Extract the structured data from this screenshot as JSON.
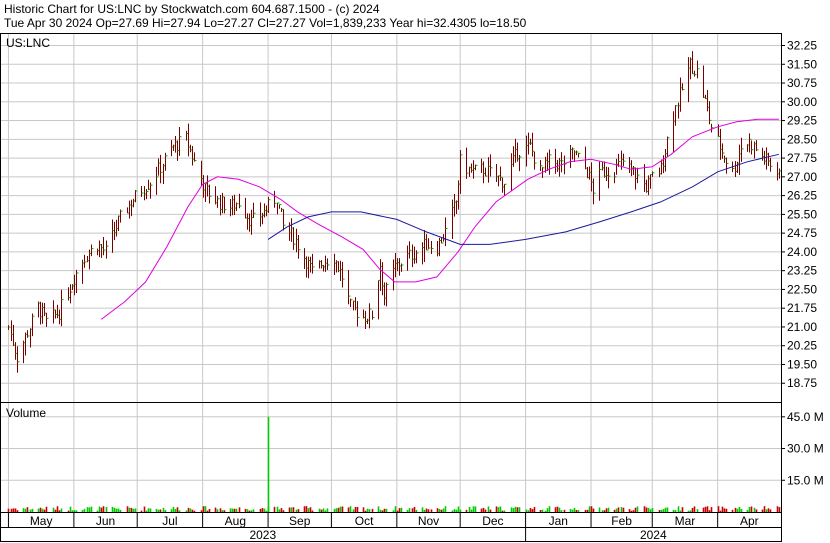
{
  "header": {
    "line1": "Historic Chart for US:LNC by Stockwatch.com 604.687.1500 - (c) 2024",
    "line2": "Tue Apr 30 2024   Op=27.69  Hi=27.94  Lo=27.27  Cl=27.27  Vol=1,839,233  Year hi=32.4305  lo=18.50"
  },
  "chart_data": {
    "type": "ohlc",
    "symbol_label": "US:LNC",
    "volume_label": "Volume",
    "price_ticks": [
      "32.25",
      "31.50",
      "30.75",
      "30.00",
      "29.25",
      "28.50",
      "27.75",
      "27.00",
      "26.25",
      "25.50",
      "24.75",
      "24.00",
      "23.25",
      "22.50",
      "21.75",
      "21.00",
      "20.25",
      "19.50",
      "18.75"
    ],
    "volume_ticks": [
      "45.0 M",
      "30.0 M",
      "15.0 M"
    ],
    "month_labels": [
      "May",
      "Jun",
      "Jul",
      "Aug",
      "Sep",
      "Oct",
      "Nov",
      "Dec",
      "Jan",
      "Feb",
      "Mar",
      "Apr"
    ],
    "year_labels": [
      "2023",
      "2024"
    ],
    "price_range": [
      18.0,
      32.75
    ],
    "volume_range_millions": [
      0,
      52
    ],
    "price_series": [
      [
        "2023-05-01",
        21.0
      ],
      [
        "2023-05-05",
        19.8
      ],
      [
        "2023-05-10",
        20.8
      ],
      [
        "2023-05-15",
        21.8
      ],
      [
        "2023-05-19",
        21.2
      ],
      [
        "2023-05-25",
        21.6
      ],
      [
        "2023-06-01",
        23.0
      ],
      [
        "2023-06-06",
        23.8
      ],
      [
        "2023-06-12",
        24.3
      ],
      [
        "2023-06-16",
        24.0
      ],
      [
        "2023-06-22",
        25.2
      ],
      [
        "2023-06-28",
        26.0
      ],
      [
        "2023-07-03",
        26.5
      ],
      [
        "2023-07-07",
        26.8
      ],
      [
        "2023-07-12",
        27.4
      ],
      [
        "2023-07-18",
        28.2
      ],
      [
        "2023-07-24",
        28.5
      ],
      [
        "2023-07-28",
        27.6
      ],
      [
        "2023-08-02",
        26.5
      ],
      [
        "2023-08-08",
        26.0
      ],
      [
        "2023-08-14",
        25.8
      ],
      [
        "2023-08-18",
        26.0
      ],
      [
        "2023-08-24",
        25.2
      ],
      [
        "2023-08-30",
        25.6
      ],
      [
        "2023-09-05",
        26.2
      ],
      [
        "2023-09-08",
        25.0
      ],
      [
        "2023-09-13",
        24.6
      ],
      [
        "2023-09-18",
        23.8
      ],
      [
        "2023-09-22",
        23.2
      ],
      [
        "2023-09-27",
        23.6
      ],
      [
        "2023-10-02",
        23.8
      ],
      [
        "2023-10-06",
        23.0
      ],
      [
        "2023-10-10",
        21.8
      ],
      [
        "2023-10-16",
        21.4
      ],
      [
        "2023-10-20",
        21.5
      ],
      [
        "2023-10-24",
        23.5
      ],
      [
        "2023-10-26",
        22.2
      ],
      [
        "2023-10-31",
        23.4
      ],
      [
        "2023-11-06",
        23.8
      ],
      [
        "2023-11-10",
        24.0
      ],
      [
        "2023-11-15",
        24.3
      ],
      [
        "2023-11-20",
        24.2
      ],
      [
        "2023-11-24",
        24.8
      ],
      [
        "2023-11-29",
        26.0
      ],
      [
        "2023-12-01",
        27.6
      ],
      [
        "2023-12-06",
        27.2
      ],
      [
        "2023-12-12",
        27.3
      ],
      [
        "2023-12-18",
        27.0
      ],
      [
        "2023-12-22",
        26.8
      ],
      [
        "2023-12-28",
        28.0
      ],
      [
        "2024-01-03",
        28.2
      ],
      [
        "2024-01-08",
        27.2
      ],
      [
        "2024-01-12",
        27.6
      ],
      [
        "2024-01-18",
        27.5
      ],
      [
        "2024-01-24",
        28.0
      ],
      [
        "2024-01-30",
        27.2
      ],
      [
        "2024-02-02",
        26.5
      ],
      [
        "2024-02-06",
        27.2
      ],
      [
        "2024-02-12",
        27.3
      ],
      [
        "2024-02-16",
        27.6
      ],
      [
        "2024-02-22",
        27.1
      ],
      [
        "2024-02-27",
        26.6
      ],
      [
        "2024-03-01",
        27.0
      ],
      [
        "2024-03-05",
        27.3
      ],
      [
        "2024-03-08",
        28.5
      ],
      [
        "2024-03-12",
        29.8
      ],
      [
        "2024-03-15",
        30.5
      ],
      [
        "2024-03-19",
        31.5
      ],
      [
        "2024-03-22",
        31.2
      ],
      [
        "2024-03-26",
        30.0
      ],
      [
        "2024-03-29",
        29.0
      ],
      [
        "2024-04-03",
        28.0
      ],
      [
        "2024-04-08",
        27.2
      ],
      [
        "2024-04-12",
        28.2
      ],
      [
        "2024-04-16",
        28.4
      ],
      [
        "2024-04-22",
        27.8
      ],
      [
        "2024-04-26",
        27.5
      ],
      [
        "2024-04-30",
        27.27
      ]
    ],
    "ma_fast": [
      [
        "2023-06-14",
        21.3
      ],
      [
        "2023-06-25",
        22.0
      ],
      [
        "2023-07-05",
        22.8
      ],
      [
        "2023-07-15",
        24.2
      ],
      [
        "2023-07-25",
        25.8
      ],
      [
        "2023-08-01",
        26.7
      ],
      [
        "2023-08-08",
        27.0
      ],
      [
        "2023-08-18",
        26.9
      ],
      [
        "2023-08-28",
        26.6
      ],
      [
        "2023-09-07",
        26.1
      ],
      [
        "2023-09-15",
        25.6
      ],
      [
        "2023-09-25",
        25.1
      ],
      [
        "2023-10-06",
        24.6
      ],
      [
        "2023-10-16",
        24.1
      ],
      [
        "2023-10-24",
        23.3
      ],
      [
        "2023-10-31",
        22.8
      ],
      [
        "2023-11-10",
        22.8
      ],
      [
        "2023-11-20",
        23.0
      ],
      [
        "2023-11-30",
        24.0
      ],
      [
        "2023-12-08",
        25.0
      ],
      [
        "2023-12-18",
        26.0
      ],
      [
        "2024-01-02",
        26.9
      ],
      [
        "2024-01-12",
        27.3
      ],
      [
        "2024-01-22",
        27.6
      ],
      [
        "2024-02-01",
        27.7
      ],
      [
        "2024-02-12",
        27.5
      ],
      [
        "2024-02-20",
        27.3
      ],
      [
        "2024-03-01",
        27.4
      ],
      [
        "2024-03-10",
        27.9
      ],
      [
        "2024-03-20",
        28.6
      ],
      [
        "2024-04-01",
        29.0
      ],
      [
        "2024-04-10",
        29.2
      ],
      [
        "2024-04-20",
        29.3
      ],
      [
        "2024-04-30",
        29.3
      ]
    ],
    "ma_slow": [
      [
        "2023-09-01",
        24.5
      ],
      [
        "2023-09-10",
        25.0
      ],
      [
        "2023-09-20",
        25.4
      ],
      [
        "2023-10-01",
        25.6
      ],
      [
        "2023-10-15",
        25.6
      ],
      [
        "2023-11-01",
        25.3
      ],
      [
        "2023-11-15",
        24.8
      ],
      [
        "2023-12-01",
        24.3
      ],
      [
        "2023-12-15",
        24.3
      ],
      [
        "2024-01-01",
        24.5
      ],
      [
        "2024-01-20",
        24.8
      ],
      [
        "2024-02-05",
        25.2
      ],
      [
        "2024-02-20",
        25.6
      ],
      [
        "2024-03-05",
        26.0
      ],
      [
        "2024-03-20",
        26.6
      ],
      [
        "2024-04-01",
        27.2
      ],
      [
        "2024-04-15",
        27.6
      ],
      [
        "2024-04-30",
        27.9
      ]
    ],
    "volume_millions": [
      [
        "2023-09-01",
        45.0
      ]
    ],
    "colors": {
      "bar": "#7a0000",
      "bar_tick": "#00aa00",
      "ma_fast": "#e000e0",
      "ma_slow": "#1a1aa0",
      "volume_up": "#00cc00",
      "volume_down": "#cc0000",
      "grid": "#c8c8c8",
      "frame": "#000000"
    }
  }
}
